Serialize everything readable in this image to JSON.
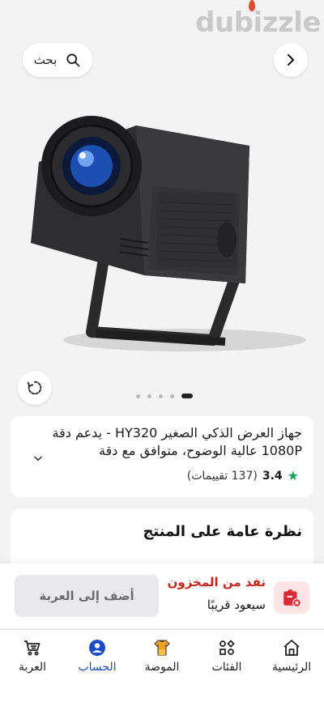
{
  "brand": {
    "watermark": "dubizzle",
    "accent": "#e04a2f"
  },
  "top": {
    "search_label": "بحث",
    "search_icon": "search-icon",
    "next_icon": "chevron-right-icon",
    "rotate_icon": "rotate-360-icon"
  },
  "gallery": {
    "total_images": 5,
    "active_index": 5
  },
  "product": {
    "title": "جهاز العرض الذكي الصغير HY320 - يدعم دقة 1080P عالية الوضوح، متوافق مع دقة",
    "rating_score": "3.4",
    "rating_count": "(137 تقييمات)",
    "rating_color": "#18a058"
  },
  "overview": {
    "title": "نظرة عامة على المنتج"
  },
  "action_bar": {
    "add_to_cart": "أضف إلى العربة",
    "stock_status": "نفد من المخزون",
    "stock_sub": "سيعود قريبًا",
    "stock_color": "#c2281f"
  },
  "nav": {
    "items": [
      {
        "label": "الرئيسية",
        "icon": "home-icon"
      },
      {
        "label": "الفئات",
        "icon": "categories-icon"
      },
      {
        "label": "الموضة",
        "icon": "fashion-icon"
      },
      {
        "label": "الحساب",
        "icon": "account-icon",
        "active": true
      },
      {
        "label": "العربة",
        "icon": "cart-icon"
      }
    ],
    "active_color": "#1a4ec7"
  }
}
